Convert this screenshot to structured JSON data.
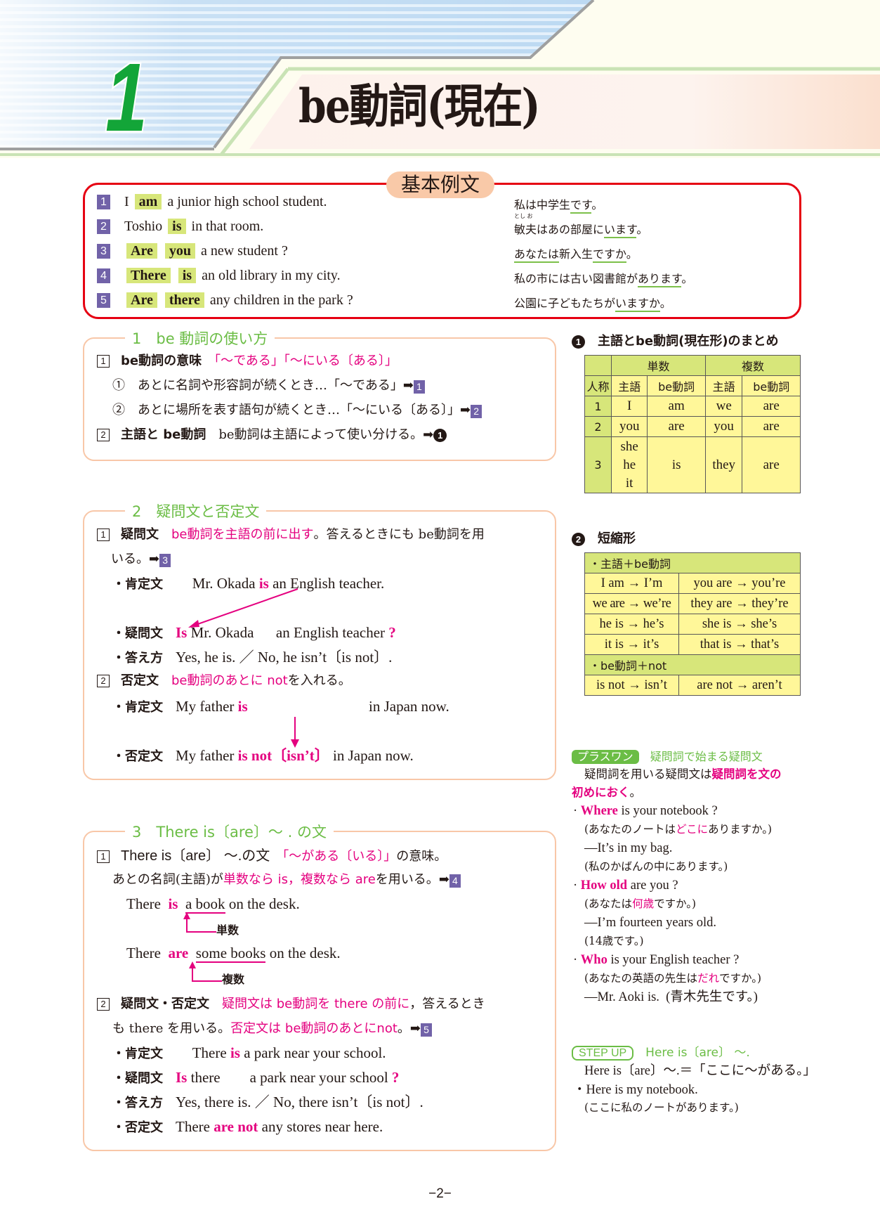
{
  "header": {
    "chapter_number": "1",
    "chapter_title": "be動詞(現在)"
  },
  "examples": {
    "label": "基本例文",
    "rows": [
      {
        "num": "1",
        "pre": "I",
        "hl": [
          "am"
        ],
        "post": "a junior high school student.",
        "ja_parts": [
          "私は中学生",
          "です",
          "。"
        ]
      },
      {
        "num": "2",
        "pre": "Toshio",
        "hl": [
          "is"
        ],
        "post": "in that room.",
        "ja_ruby": "とし お",
        "ja_parts": [
          "敏夫はあの部屋に",
          "います",
          "。"
        ]
      },
      {
        "num": "3",
        "pre": "",
        "hl": [
          "Are",
          "you"
        ],
        "post": "a new student ?",
        "ja_parts": [
          "あなたは",
          "新入生",
          "ですか",
          "。"
        ]
      },
      {
        "num": "4",
        "pre": "",
        "hl": [
          "There",
          "is"
        ],
        "post": "an old library in my city.",
        "ja_parts": [
          "私の市には古い図書館が",
          "あります",
          "。"
        ]
      },
      {
        "num": "5",
        "pre": "",
        "hl": [
          "Are",
          "there"
        ],
        "post": "any children in the park ?",
        "ja_parts": [
          "公園に子どもたちが",
          "いますか",
          "。"
        ]
      }
    ]
  },
  "section1": {
    "title": "1　be 動詞の使い方",
    "item1": {
      "num": "1",
      "label": "be動詞の意味",
      "meaning": "「〜である」「〜にいる〔ある〕」"
    },
    "sub1": {
      "mark": "①",
      "text": "あとに名詞や形容詞が続くとき…「〜である」",
      "ref": "1"
    },
    "sub2": {
      "mark": "②",
      "text": "あとに場所を表す語句が続くとき…「〜にいる〔ある〕」",
      "ref": "2"
    },
    "item2": {
      "num": "2",
      "label": "主語と be動詞",
      "text": "be動詞は主語によって使い分ける。",
      "ref": "1"
    },
    "arrow": "➡"
  },
  "section2": {
    "title": "2　疑問文と否定文",
    "item1": {
      "num": "1",
      "label": "疑問文",
      "pink": "be動詞を主語の前に出す",
      "text": "。答えるときにも be動詞を用",
      "text2": "いる。",
      "ref": "3"
    },
    "aff1": {
      "label": "・肯定文",
      "pre": "Mr. Okada ",
      "pink": "is",
      "post": " an English teacher."
    },
    "q1": {
      "label": "・疑問文",
      "pink": "Is",
      "mid": " Mr. Okada　  an English teacher ",
      "q": "?"
    },
    "ans1": {
      "label": "・答え方",
      "text": "Yes, he is. ／ No, he isn’t〔is not〕."
    },
    "item2": {
      "num": "2",
      "label": "否定文",
      "pink": "be動詞のあとに not",
      "text": "を入れる。"
    },
    "aff2": {
      "label": "・肯定文",
      "pre": "My father ",
      "pink": "is",
      "post": "in Japan now."
    },
    "neg2": {
      "label": "・否定文",
      "pre": "My father ",
      "pink": "is not〔isn’t〕",
      "post": " in Japan now."
    }
  },
  "section3": {
    "title": "3　There is〔are〕〜 . の文",
    "item1": {
      "num": "1",
      "label": "There is〔are〕 〜.の文",
      "pink": "「〜がある〔いる〕」",
      "text": "の意味。"
    },
    "line2": {
      "pre": "あとの名詞(主語)が",
      "pink": "単数なら is，複数なら are",
      "post": "を用いる。",
      "ref": "4"
    },
    "ex1": {
      "pre": "There ",
      "pink": "is",
      "ul": "a book",
      "post": " on the desk.",
      "note": "単数"
    },
    "ex2": {
      "pre": "There ",
      "pink": "are",
      "ul": "some books",
      "post": " on the desk.",
      "note": "複数"
    },
    "item2": {
      "num": "2",
      "label": "疑問文・否定文",
      "pink": "疑問文は be動詞を there の前に",
      "text": "，答えるとき"
    },
    "line4": {
      "pre": "も there を用いる。",
      "pink": "否定文は be動詞のあとにnot",
      "post": "。",
      "ref": "5"
    },
    "aff": {
      "label": "・肯定文",
      "pre": "There ",
      "pink": "is",
      "post": " a park near your school."
    },
    "q": {
      "label": "・疑問文",
      "pink": "Is",
      "mid": " there　　a park near your school ",
      "q": "?"
    },
    "ans": {
      "label": "・答え方",
      "text": "Yes, there is. ／ No, there isn’t〔is not〕."
    },
    "neg": {
      "label": "・否定文",
      "pre": "There ",
      "pink": "are not",
      "post": " any stores near here."
    }
  },
  "summary_table": {
    "title": "主語とbe動詞(現在形)のまとめ",
    "num": "1",
    "head_singular": "単数",
    "head_plural": "複数",
    "col_person": "人称",
    "col_subject": "主語",
    "col_be": "be動詞",
    "rows": [
      {
        "person": "1",
        "s_sub": "I",
        "s_be": "am",
        "p_sub": "we",
        "p_be": "are"
      },
      {
        "person": "2",
        "s_sub": "you",
        "s_be": "are",
        "p_sub": "you",
        "p_be": "are"
      },
      {
        "person": "3",
        "s_sub_lines": [
          "she",
          "he",
          "it"
        ],
        "s_be": "is",
        "p_sub": "they",
        "p_be": "are"
      }
    ]
  },
  "contraction_table": {
    "title": "短縮形",
    "num": "2",
    "group1": "・主語＋be動詞",
    "pairs1": [
      [
        "I am → I’m",
        "you are → you’re"
      ],
      [
        "we are → we’re",
        "they are → they’re"
      ],
      [
        "he is → he’s",
        "she is → she’s"
      ],
      [
        "it is → it’s",
        "that is → that’s"
      ]
    ],
    "group2": "・be動詞＋not",
    "pairs2": [
      [
        "is not → isn’t",
        "are not → aren’t"
      ]
    ]
  },
  "plus_one": {
    "tag": "プラスワン",
    "title": "疑問詞で始まる疑問文",
    "intro1": "疑問詞を用いる疑問文は",
    "intro1_pink": "疑問詞を文の",
    "intro2_pink": "初めにおく",
    "intro2": "。",
    "examples": [
      {
        "q_pink": "Where",
        "q": " is your notebook ?",
        "q_ja_pre": "(あなたのノートは",
        "q_ja_pink": "どこに",
        "q_ja_post": "ありますか。)",
        "a": "—It’s in my bag.",
        "a_ja": "(私のかばんの中にあります。)"
      },
      {
        "q_pink": "How old",
        "q": " are you ?",
        "q_ja_pre": "(あなたは",
        "q_ja_pink": "何歳",
        "q_ja_post": "ですか。)",
        "a": "—I’m fourteen years old.",
        "a_ja": "(14歳です。)"
      },
      {
        "q_pink": "Who",
        "q": " is your English teacher ?",
        "q_ja_pre": "(あなたの英語の先生は",
        "q_ja_pink": "だれ",
        "q_ja_post": "ですか。)",
        "a": "—Mr. Aoki is.  (青木先生です。)",
        "a_ja": ""
      }
    ]
  },
  "step_up": {
    "tag": "STEP UP",
    "title": "Here is〔are〕 〜.",
    "line1": "Here is〔are〕〜.＝「ここに〜がある。」",
    "line2": "・Here is my notebook.",
    "line3": "(ここに私のノートがあります。)"
  },
  "page_number": "−2−"
}
